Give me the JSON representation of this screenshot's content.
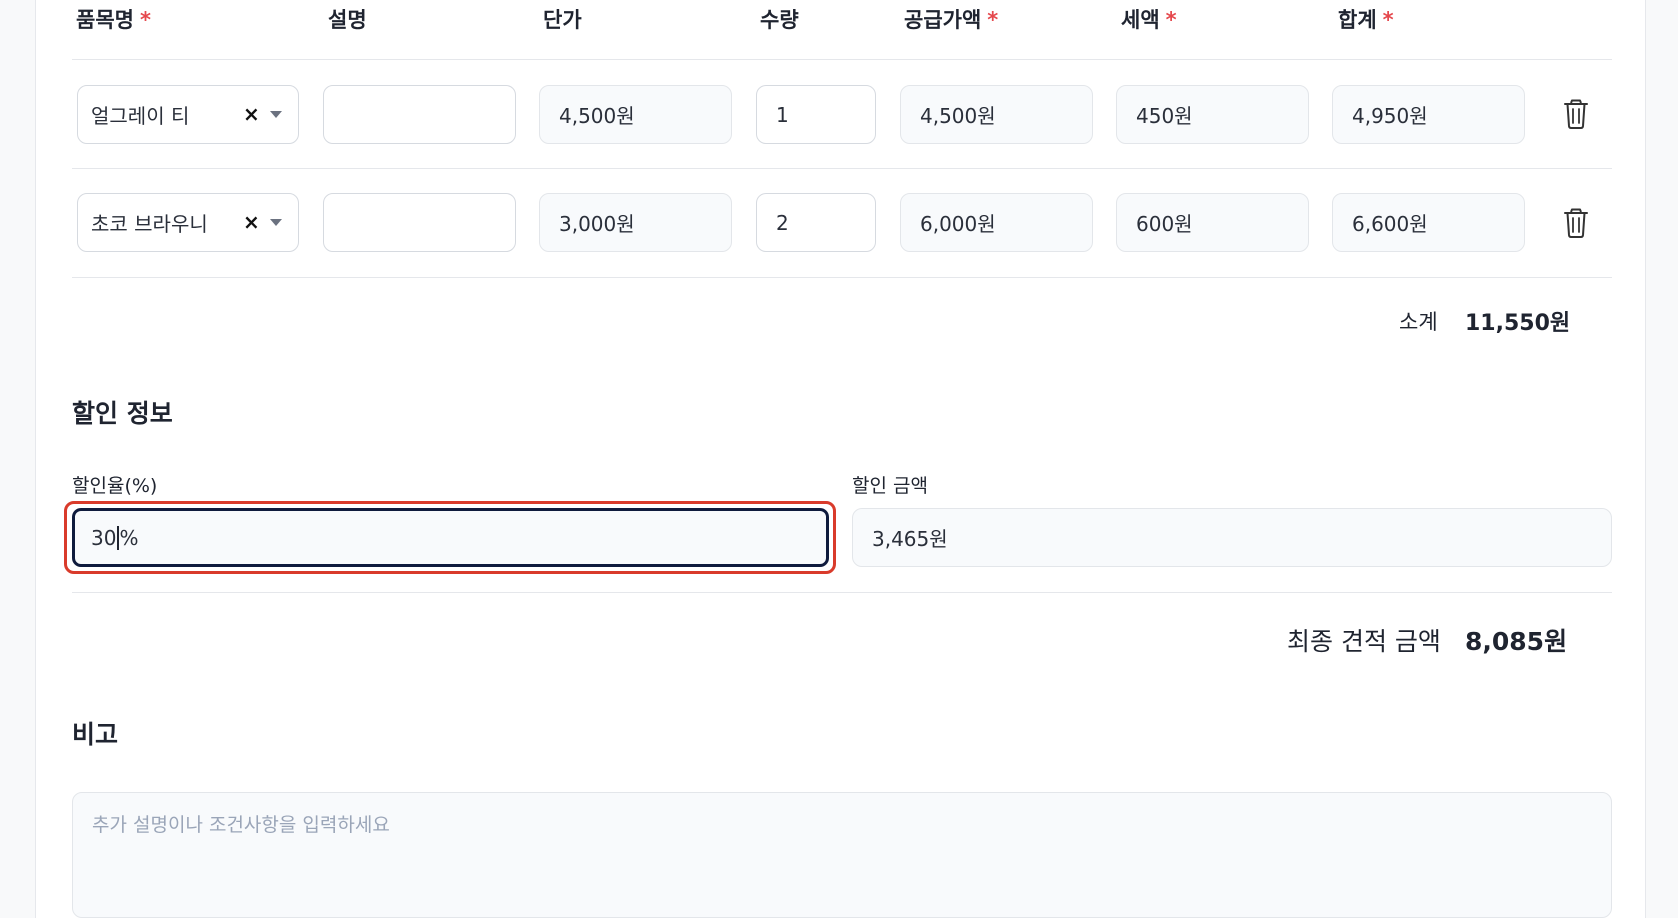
{
  "table": {
    "headers": [
      {
        "label": "품목명",
        "required": "*"
      },
      {
        "label": "설명",
        "required": ""
      },
      {
        "label": "단가",
        "required": ""
      },
      {
        "label": "수량",
        "required": ""
      },
      {
        "label": "공급가액",
        "required": "*"
      },
      {
        "label": "세액",
        "required": "*"
      },
      {
        "label": "합계",
        "required": "*"
      }
    ],
    "rows": [
      {
        "item": "얼그레이 티",
        "clear": "×",
        "description": "",
        "unit_price": "4,500원",
        "quantity": "1",
        "supply": "4,500원",
        "tax": "450원",
        "total": "4,950원"
      },
      {
        "item": "초코 브라우니",
        "clear": "×",
        "description": "",
        "unit_price": "3,000원",
        "quantity": "2",
        "supply": "6,000원",
        "tax": "600원",
        "total": "6,600원"
      }
    ],
    "subtotal_label": "소계",
    "subtotal_value": "11,550원"
  },
  "discount": {
    "title": "할인 정보",
    "rate_label": "할인율(%)",
    "rate_value_before_cursor": "30",
    "rate_value_after_cursor": "%",
    "amount_label": "할인 금액",
    "amount_value": "3,465원"
  },
  "final": {
    "label": "최종 견적 금액",
    "value": "8,085원"
  },
  "notes": {
    "title": "비고",
    "placeholder": "추가 설명이나 조건사항을 입력하세요"
  },
  "icons": {
    "delete": "trash-icon",
    "dropdown": "chevron-down-icon",
    "clear": "close-icon"
  },
  "colors": {
    "required": "#e5484d",
    "focus_highlight": "#d93b2b",
    "focus_border": "#0f1b3d"
  }
}
